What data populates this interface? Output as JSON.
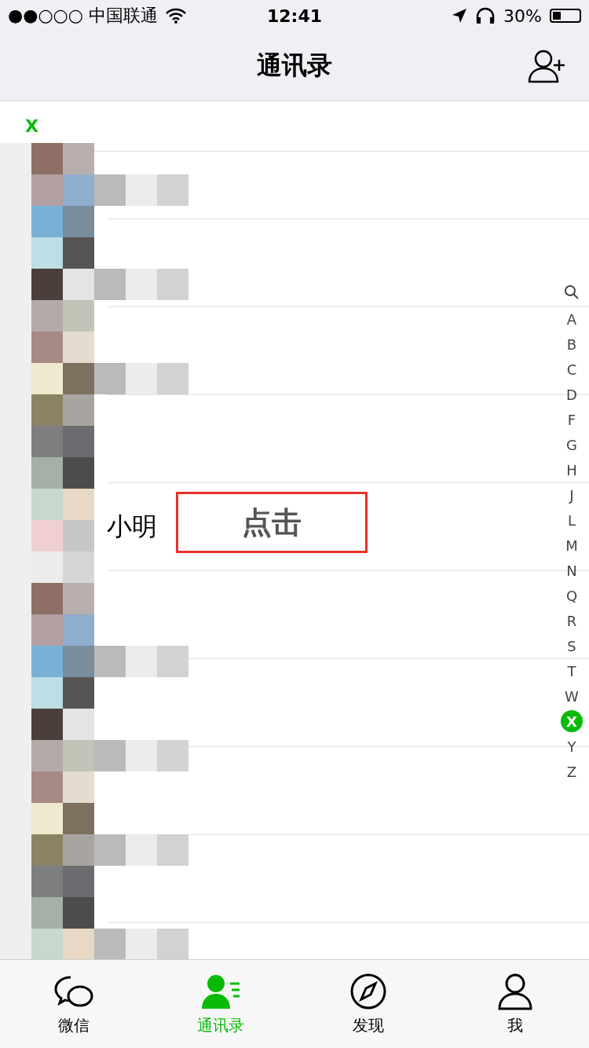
{
  "status_bar": {
    "carrier": "●●○○○ 中国联通",
    "time": "12:41",
    "battery": "30%"
  },
  "nav": {
    "title": "通讯录"
  },
  "section": {
    "letter": "X"
  },
  "rows": [
    {
      "kind": "blank"
    },
    {
      "kind": "blank"
    },
    {
      "kind": "blank"
    },
    {
      "kind": "blank"
    },
    {
      "kind": "contact",
      "name": "小明"
    },
    {
      "kind": "blank"
    },
    {
      "kind": "blank"
    },
    {
      "kind": "blank"
    },
    {
      "kind": "blank"
    }
  ],
  "annotation": {
    "text": "点击"
  },
  "index": [
    {
      "label": "A",
      "selected": false
    },
    {
      "label": "B",
      "selected": false
    },
    {
      "label": "C",
      "selected": false
    },
    {
      "label": "D",
      "selected": false
    },
    {
      "label": "F",
      "selected": false
    },
    {
      "label": "G",
      "selected": false
    },
    {
      "label": "H",
      "selected": false
    },
    {
      "label": "J",
      "selected": false
    },
    {
      "label": "L",
      "selected": false
    },
    {
      "label": "M",
      "selected": false
    },
    {
      "label": "N",
      "selected": false
    },
    {
      "label": "Q",
      "selected": false
    },
    {
      "label": "R",
      "selected": false
    },
    {
      "label": "S",
      "selected": false
    },
    {
      "label": "T",
      "selected": false
    },
    {
      "label": "W",
      "selected": false
    },
    {
      "label": "X",
      "selected": true
    },
    {
      "label": "Y",
      "selected": false
    },
    {
      "label": "Z",
      "selected": false
    }
  ],
  "tabs": [
    {
      "label": "微信",
      "kind": "chat",
      "selected": false
    },
    {
      "label": "通讯录",
      "kind": "contacts",
      "selected": true
    },
    {
      "label": "发现",
      "kind": "discover",
      "selected": false
    },
    {
      "label": "我",
      "kind": "me",
      "selected": false
    }
  ]
}
